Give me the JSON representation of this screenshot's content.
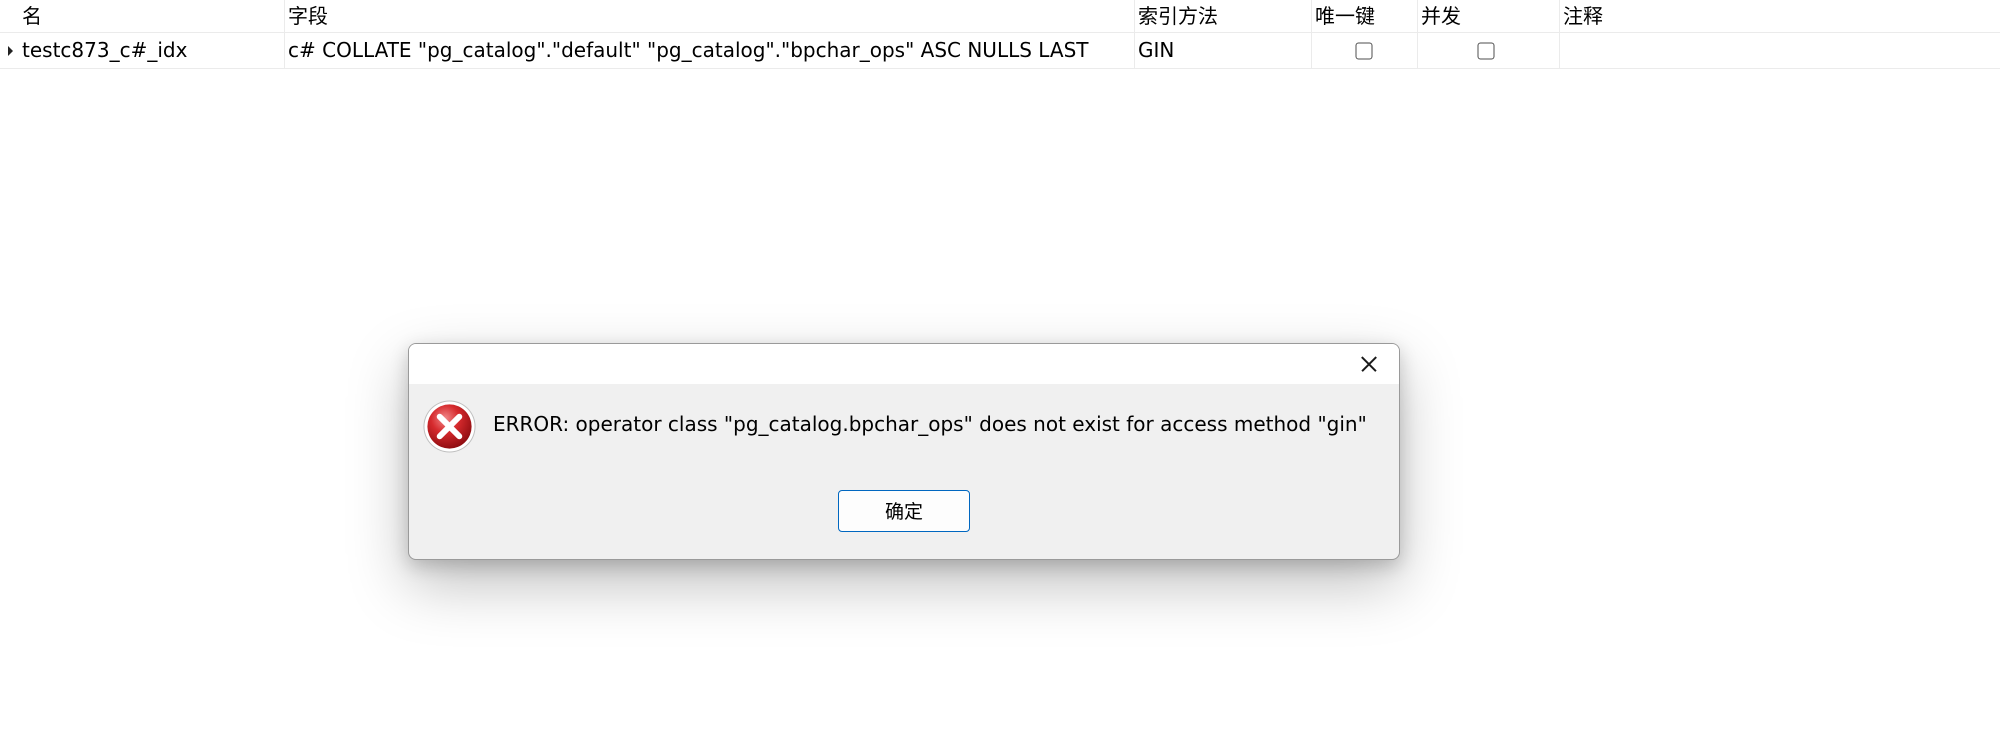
{
  "grid": {
    "columns": [
      {
        "key": "name",
        "label": "名"
      },
      {
        "key": "fields",
        "label": "字段"
      },
      {
        "key": "index_method",
        "label": "索引方法"
      },
      {
        "key": "unique",
        "label": "唯一键"
      },
      {
        "key": "concurrent",
        "label": "并发"
      },
      {
        "key": "comment",
        "label": "注释"
      }
    ],
    "rows": [
      {
        "name": "testc873_c#_idx",
        "fields": "c# COLLATE \"pg_catalog\".\"default\" \"pg_catalog\".\"bpchar_ops\" ASC NULLS LAST",
        "index_method": "GIN",
        "unique": false,
        "concurrent": false,
        "comment": ""
      }
    ]
  },
  "dialog": {
    "icon": "error-icon",
    "message": "ERROR:  operator class \"pg_catalog.bpchar_ops\" does not exist for access method \"gin\"",
    "ok_label": "确定",
    "close_icon": "close-icon"
  },
  "colors": {
    "dialog_button_border": "#0067c0",
    "error_icon_red": "#c8191c",
    "grid_line": "#ebebeb"
  }
}
